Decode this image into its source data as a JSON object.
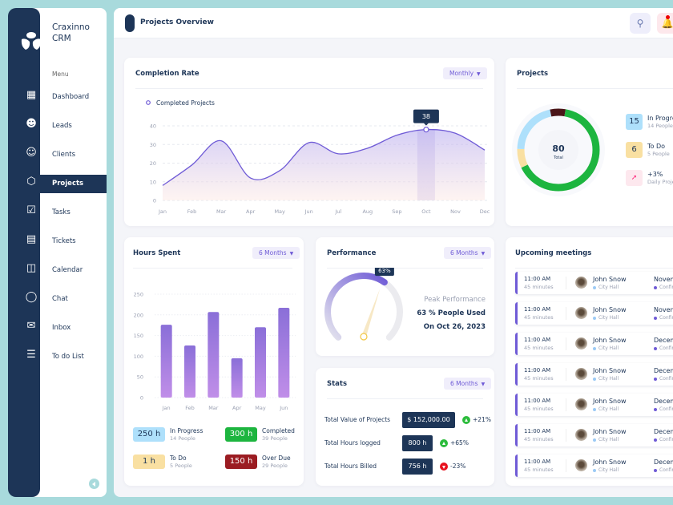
{
  "app": {
    "name_line1": "Craxinno",
    "name_line2": "CRM",
    "menu_label": "Menu"
  },
  "sidebar": {
    "items": [
      {
        "label": "Dashboard",
        "icon": "grid-icon"
      },
      {
        "label": "Leads",
        "icon": "user-plus-icon"
      },
      {
        "label": "Clients",
        "icon": "user-check-icon"
      },
      {
        "label": "Projects",
        "icon": "cube-icon",
        "active": true
      },
      {
        "label": "Tasks",
        "icon": "clipboard-check-icon"
      },
      {
        "label": "Tickets",
        "icon": "ticket-icon"
      },
      {
        "label": "Calendar",
        "icon": "calendar-icon"
      },
      {
        "label": "Chat",
        "icon": "chat-icon"
      },
      {
        "label": "Inbox",
        "icon": "mail-icon"
      },
      {
        "label": "To do List",
        "icon": "todo-list-icon"
      }
    ]
  },
  "header": {
    "title": "Projects Overview"
  },
  "colors": {
    "navy": "#1d3557",
    "accent": "#6f5bd6",
    "teal": "#a8dadc",
    "green": "#1db53f",
    "yellow": "#f9e0a2",
    "lightblue": "#aee0fb",
    "darkred": "#9b1c22"
  },
  "completion": {
    "title": "Completion Rate",
    "filter": "Monthly",
    "tooltip": "38"
  },
  "projects": {
    "title": "Projects",
    "total": "80",
    "total_label": "Total",
    "legend": [
      {
        "value": "15",
        "label": "In Progress",
        "sub": "14 People"
      },
      {
        "value": "6",
        "label": "To Do",
        "sub": "5 People"
      },
      {
        "value": "",
        "label": "+3%",
        "sub": "Daily Projects"
      }
    ]
  },
  "hours": {
    "title": "Hours Spent",
    "filter": "6 Months",
    "summary": [
      {
        "value": "250 h",
        "label": "In Progress",
        "sub": "14 People"
      },
      {
        "value": "300 h",
        "label": "Completed",
        "sub": "39 People"
      },
      {
        "value": "1 h",
        "label": "To Do",
        "sub": "5 People"
      },
      {
        "value": "150 h",
        "label": "Over Due",
        "sub": "29 People"
      }
    ]
  },
  "performance": {
    "title": "Performance",
    "filter": "6 Months",
    "value": 63,
    "badge": "63%",
    "line1": "Peak Performance",
    "line2": "63 % People Used",
    "line3": "On Oct 26, 2023"
  },
  "stats": {
    "title": "Stats",
    "filter": "6 Months",
    "rows": [
      {
        "label": "Total Value of Projects",
        "value": "$ 152,000.00",
        "change": "+21%",
        "up": true
      },
      {
        "label": "Total Hours logged",
        "value": "800 h",
        "change": "+65%",
        "up": true
      },
      {
        "label": "Total Hours Billed",
        "value": "756 h",
        "change": "-23%",
        "up": false
      }
    ]
  },
  "meetings": {
    "title": "Upcoming meetings",
    "rows": [
      {
        "time": "11:00 AM",
        "duration": "45 minutes",
        "name": "John Snow",
        "location": "City Hall",
        "date": "November",
        "status": "Confirmed"
      },
      {
        "time": "11:00 AM",
        "duration": "45 minutes",
        "name": "John Snow",
        "location": "City Hall",
        "date": "November",
        "status": "Confirmed"
      },
      {
        "time": "11:00 AM",
        "duration": "45 minutes",
        "name": "John Snow",
        "location": "City Hall",
        "date": "December",
        "status": "Confirmed"
      },
      {
        "time": "11:00 AM",
        "duration": "45 minutes",
        "name": "John Snow",
        "location": "City Hall",
        "date": "December",
        "status": "Confirmed"
      },
      {
        "time": "11:00 AM",
        "duration": "45 minutes",
        "name": "John Snow",
        "location": "City Hall",
        "date": "December",
        "status": "Confirmed"
      },
      {
        "time": "11:00 AM",
        "duration": "45 minutes",
        "name": "John Snow",
        "location": "City Hall",
        "date": "December",
        "status": "Confirmed"
      },
      {
        "time": "11:00 AM",
        "duration": "45 minutes",
        "name": "John Snow",
        "location": "City Hall",
        "date": "December",
        "status": "Confirmed"
      }
    ]
  },
  "chart_data": [
    {
      "type": "area",
      "legend": "Completed Projects",
      "categories": [
        "Jan",
        "Feb",
        "Mar",
        "Apr",
        "May",
        "Jun",
        "Jul",
        "Aug",
        "Sep",
        "Oct",
        "Nov",
        "Dec"
      ],
      "values": [
        8,
        19,
        32,
        12,
        16,
        31,
        25,
        28,
        35,
        38,
        36,
        27
      ],
      "ylim": [
        0,
        40
      ],
      "yticks": [
        0,
        10,
        20,
        30,
        40
      ],
      "highlight": "Oct",
      "grid": true
    },
    {
      "type": "bar",
      "categories": [
        "Jan",
        "Feb",
        "Mar",
        "Apr",
        "May",
        "Jun"
      ],
      "values": [
        176,
        126,
        207,
        95,
        170,
        217
      ],
      "ylim": [
        0,
        250
      ],
      "yticks": [
        0,
        50,
        100,
        150,
        200,
        250
      ],
      "grid": true
    },
    {
      "type": "pie",
      "title": "Projects",
      "total": 80,
      "slices": [
        {
          "label": "Completed",
          "color": "#1db53f",
          "value": 52
        },
        {
          "label": "To Do",
          "color": "#f9e0a2",
          "value": 6
        },
        {
          "label": "In Progress",
          "color": "#aee0fb",
          "value": 17
        },
        {
          "label": "Over Due",
          "color": "#4a1518",
          "value": 5
        }
      ]
    }
  ]
}
